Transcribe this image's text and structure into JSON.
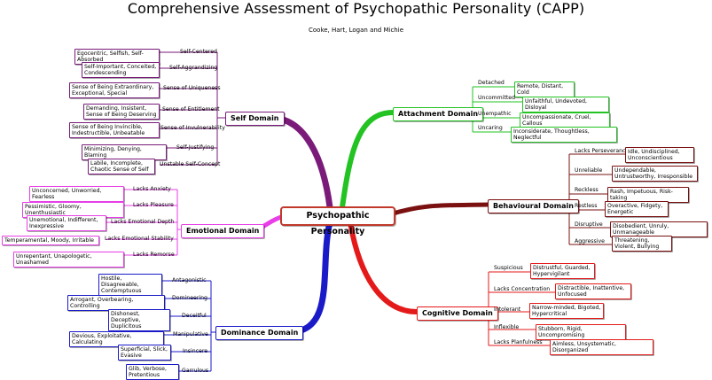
{
  "title": "Comprehensive Assessment of Psychopathic Personality (CAPP)",
  "subtitle": "Cooke, Hart, Logan and Michie",
  "center": "Psychopathic Personality",
  "colors": {
    "self": "#7a1b7a",
    "emotional": "#e83ee8",
    "dominance": "#1a1ac8",
    "attachment": "#22c322",
    "behavioural": "#7a1010",
    "cognitive": "#e41a1a"
  },
  "self": {
    "domain": "Self Domain",
    "items": [
      {
        "label": "Self-Centered",
        "desc": "Egocentric, Selfish, Self-Absorbed"
      },
      {
        "label": "Self-Aggrandizing",
        "desc": "Self-Important, Conceited, Condescending"
      },
      {
        "label": "Sense of Uniqueness",
        "desc": "Sense of Being Extraordinary, Exceptional, Special"
      },
      {
        "label": "Sense of Entitlement",
        "desc": "Demanding, Insistent, Sense of Being Deserving"
      },
      {
        "label": "Sense of Invulnerability",
        "desc": "Sense of Being Invincible, Indestructible, Unbeatable"
      },
      {
        "label": "Self-Justifying",
        "desc": "Minimizing, Denying, Blaming"
      },
      {
        "label": "Unstable Self-Concept",
        "desc": "Labile, Incomplete, Chaotic Sense of Self"
      }
    ]
  },
  "emotional": {
    "domain": "Emotional Domain",
    "items": [
      {
        "label": "Lacks Anxiety",
        "desc": "Unconcerned, Unworried, Fearless"
      },
      {
        "label": "Lacks Pleasure",
        "desc": "Pessimistic, Gloomy, Unenthusiastic"
      },
      {
        "label": "Lacks Emotional Depth",
        "desc": "Unemotional, Indifferent, Inexpressive"
      },
      {
        "label": "Lacks Emotional Stability",
        "desc": "Temperamental, Moody, Irritable"
      },
      {
        "label": "Lacks Remorse",
        "desc": "Unrepentant, Unapologetic, Unashamed"
      }
    ]
  },
  "dominance": {
    "domain": "Dominance Domain",
    "items": [
      {
        "label": "Antagonistic",
        "desc": "Hostile, Disagreeable, Contemptuous"
      },
      {
        "label": "Domineering",
        "desc": "Arrogant, Overbearing, Controlling"
      },
      {
        "label": "Deceitful",
        "desc": "Dishonest, Deceptive, Duplicitous"
      },
      {
        "label": "Manipulative",
        "desc": "Devious, Exploitative, Calculating"
      },
      {
        "label": "Insincere",
        "desc": "Superficial, Slick, Evasive"
      },
      {
        "label": "Garrulous",
        "desc": "Glib, Verbose, Pretentious"
      }
    ]
  },
  "attachment": {
    "domain": "Attachment Domain",
    "items": [
      {
        "label": "Detached",
        "desc": "Remote, Distant, Cold"
      },
      {
        "label": "Uncommitted",
        "desc": "Unfaithful, Undevoted, Disloyal"
      },
      {
        "label": "Unempathic",
        "desc": "Uncompassionate, Cruel, Callous"
      },
      {
        "label": "Uncaring",
        "desc": "Inconsiderate, Thoughtless, Neglectful"
      }
    ]
  },
  "behavioural": {
    "domain": "Behavioural Domain",
    "items": [
      {
        "label": "Lacks Perseverance",
        "desc": "Idle, Undisciplined, Unconscientious"
      },
      {
        "label": "Unreliable",
        "desc": "Undependable, Untrustworthy, Irresponsible"
      },
      {
        "label": "Reckless",
        "desc": "Rash, Impetuous, Risk-taking"
      },
      {
        "label": "Restless",
        "desc": "Overactive, Fidgety, Energetic"
      },
      {
        "label": "Disruptive",
        "desc": "Disobedient, Unruly, Unmanageable"
      },
      {
        "label": "Aggressive",
        "desc": "Threatening, Violent, Bullying"
      }
    ]
  },
  "cognitive": {
    "domain": "Cognitive Domain",
    "items": [
      {
        "label": "Suspicious",
        "desc": "Distrustful, Guarded, Hypervigilant"
      },
      {
        "label": "Lacks Concentration",
        "desc": "Distractible, Inattentive, Unfocused"
      },
      {
        "label": "Intolerant",
        "desc": "Narrow-minded, Bigoted, Hypercritical"
      },
      {
        "label": "Inflexible",
        "desc": "Stubborn, Rigid, Uncompromising"
      },
      {
        "label": "Lacks Planfulness",
        "desc": "Aimless, Unsystematic, Disorganized"
      }
    ]
  }
}
